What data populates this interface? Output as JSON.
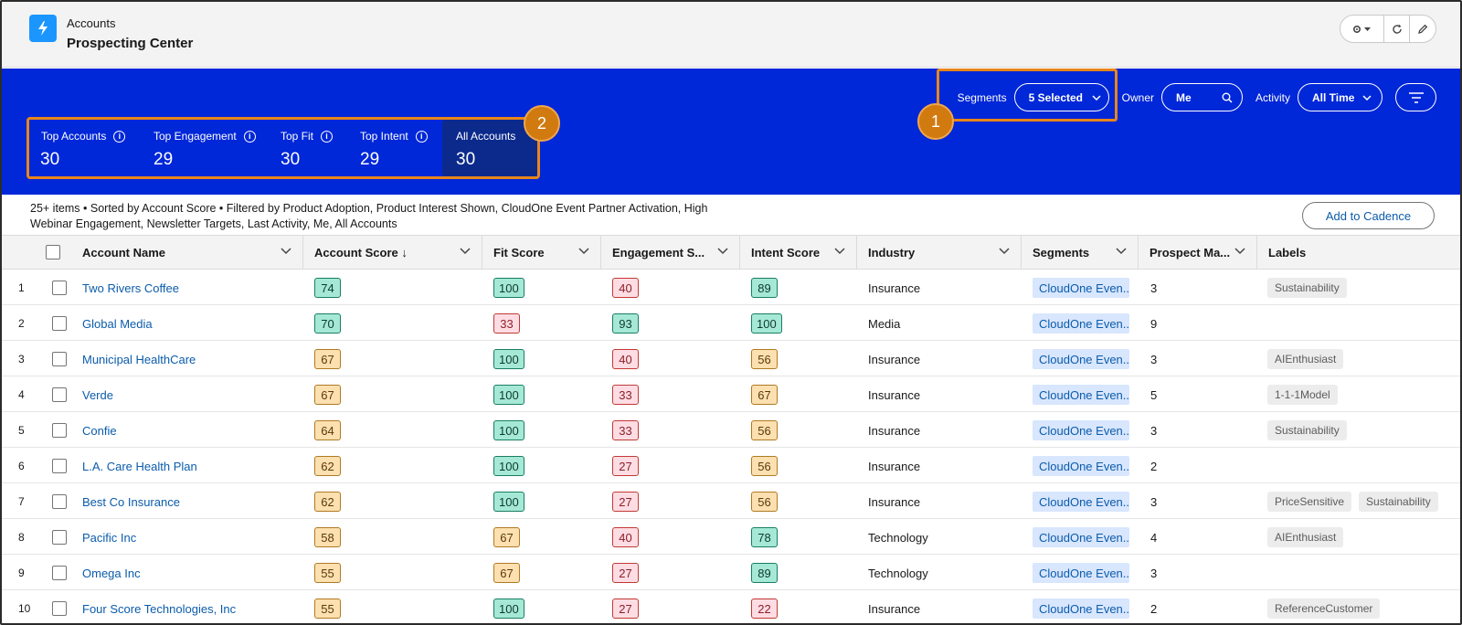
{
  "header": {
    "breadcrumb": "Accounts",
    "title": "Prospecting Center",
    "actions": [
      "settings-icon",
      "refresh-icon",
      "edit-icon"
    ]
  },
  "filters": {
    "segments_label": "Segments",
    "segments_value": "5 Selected",
    "owner_label": "Owner",
    "owner_value": "Me",
    "activity_label": "Activity",
    "activity_value": "All Time"
  },
  "tiles": [
    {
      "label": "Top Accounts",
      "value": "30",
      "info": true
    },
    {
      "label": "Top Engagement",
      "value": "29",
      "info": true
    },
    {
      "label": "Top Fit",
      "value": "30",
      "info": true
    },
    {
      "label": "Top Intent",
      "value": "29",
      "info": true
    },
    {
      "label": "All Accounts",
      "value": "30",
      "info": false,
      "active": true
    }
  ],
  "callouts": [
    "1",
    "2"
  ],
  "summary": "25+ items • Sorted by Account Score • Filtered by Product Adoption, Product Interest Shown, CloudOne Event Partner Activation, High Webinar Engagement, Newsletter Targets, Last Activity, Me, All Accounts",
  "cadence_button": "Add to Cadence",
  "columns": [
    "Account Name",
    "Account Score ↓",
    "Fit Score",
    "Engagement S...",
    "Intent Score",
    "Industry",
    "Segments",
    "Prospect Ma...",
    "Labels"
  ],
  "colors": {
    "band": "#0027d8",
    "highlight": "#e8861a",
    "link": "#0b5cab",
    "score_green": "#a6e8d6",
    "score_orange": "#fce0b0",
    "score_red": "#fddde3"
  },
  "rows": [
    {
      "num": "1",
      "name": "Two Rivers Coffee",
      "account": "74",
      "fit": "100",
      "eng": "40",
      "intent": "89",
      "industry": "Insurance",
      "segment": "CloudOne Even...",
      "prospect": "3",
      "labels": [
        "Sustainability"
      ]
    },
    {
      "num": "2",
      "name": "Global Media",
      "account": "70",
      "fit": "33",
      "eng": "93",
      "intent": "100",
      "industry": "Media",
      "segment": "CloudOne Even...",
      "prospect": "9",
      "labels": []
    },
    {
      "num": "3",
      "name": "Municipal HealthCare",
      "account": "67",
      "fit": "100",
      "eng": "40",
      "intent": "56",
      "industry": "Insurance",
      "segment": "CloudOne Even...",
      "prospect": "3",
      "labels": [
        "AIEnthusiast"
      ]
    },
    {
      "num": "4",
      "name": "Verde",
      "account": "67",
      "fit": "100",
      "eng": "33",
      "intent": "67",
      "industry": "Insurance",
      "segment": "CloudOne Even...",
      "prospect": "5",
      "labels": [
        "1-1-1Model"
      ]
    },
    {
      "num": "5",
      "name": "Confie",
      "account": "64",
      "fit": "100",
      "eng": "33",
      "intent": "56",
      "industry": "Insurance",
      "segment": "CloudOne Even...",
      "prospect": "3",
      "labels": [
        "Sustainability"
      ]
    },
    {
      "num": "6",
      "name": "L.A. Care Health Plan",
      "account": "62",
      "fit": "100",
      "eng": "27",
      "intent": "56",
      "industry": "Insurance",
      "segment": "CloudOne Even...",
      "prospect": "2",
      "labels": []
    },
    {
      "num": "7",
      "name": "Best Co Insurance",
      "account": "62",
      "fit": "100",
      "eng": "27",
      "intent": "56",
      "industry": "Insurance",
      "segment": "CloudOne Even...",
      "prospect": "3",
      "labels": [
        "PriceSensitive",
        "Sustainability"
      ]
    },
    {
      "num": "8",
      "name": "Pacific Inc",
      "account": "58",
      "fit": "67",
      "eng": "40",
      "intent": "78",
      "industry": "Technology",
      "segment": "CloudOne Even...",
      "prospect": "4",
      "labels": [
        "AIEnthusiast"
      ]
    },
    {
      "num": "9",
      "name": "Omega Inc",
      "account": "55",
      "fit": "67",
      "eng": "27",
      "intent": "89",
      "industry": "Technology",
      "segment": "CloudOne Even...",
      "prospect": "3",
      "labels": []
    },
    {
      "num": "10",
      "name": "Four Score Technologies, Inc",
      "account": "55",
      "fit": "100",
      "eng": "27",
      "intent": "22",
      "industry": "Insurance",
      "segment": "CloudOne Even...",
      "prospect": "2",
      "labels": [
        "ReferenceCustomer"
      ]
    }
  ]
}
